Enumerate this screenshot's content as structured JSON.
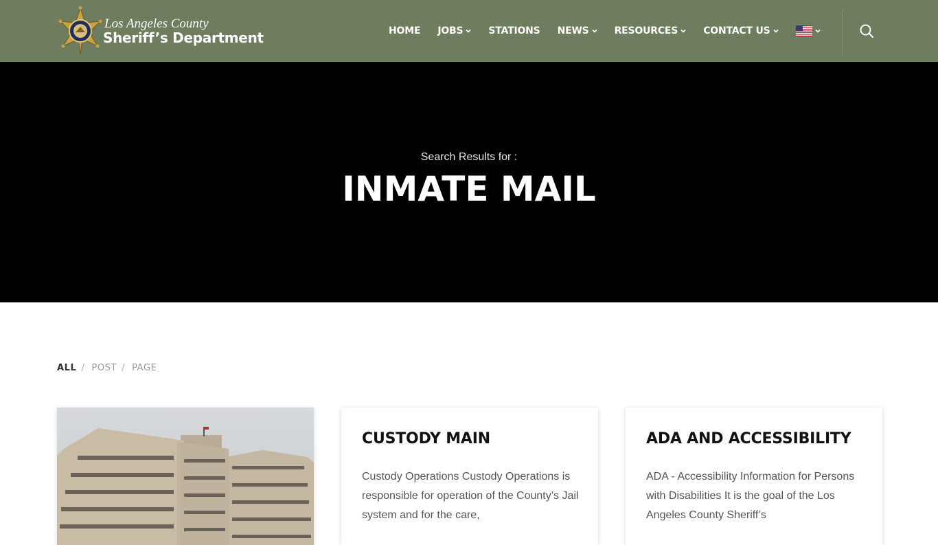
{
  "header": {
    "logo_line1": "Los Angeles County",
    "logo_line2": "Sheriff’s Department",
    "nav": [
      {
        "label": "HOME",
        "dropdown": false
      },
      {
        "label": "JOBS",
        "dropdown": true
      },
      {
        "label": "STATIONS",
        "dropdown": false
      },
      {
        "label": "NEWS",
        "dropdown": true
      },
      {
        "label": "RESOURCES",
        "dropdown": true
      },
      {
        "label": "CONTACT US",
        "dropdown": true
      }
    ],
    "language_icon": "us-flag-icon",
    "search_icon": "search-icon",
    "bg_color": "#6e7d5e"
  },
  "hero": {
    "subtitle": "Search Results for :",
    "title": "INMATE MAIL"
  },
  "filters": {
    "items": [
      "ALL",
      "POST",
      "PAGE"
    ],
    "active": "ALL"
  },
  "results": [
    {
      "type": "image",
      "image_icon": "building-photo"
    },
    {
      "title": "CUSTODY MAIN",
      "excerpt": "Custody Operations Custody Operations is responsible for operation of the County’s Jail system and for the care,"
    },
    {
      "title": "ADA AND ACCESSIBILITY",
      "excerpt": "ADA - Accessibility Information for Persons with Disabilities It is the goal of the Los Angeles County Sheriff’s"
    }
  ]
}
